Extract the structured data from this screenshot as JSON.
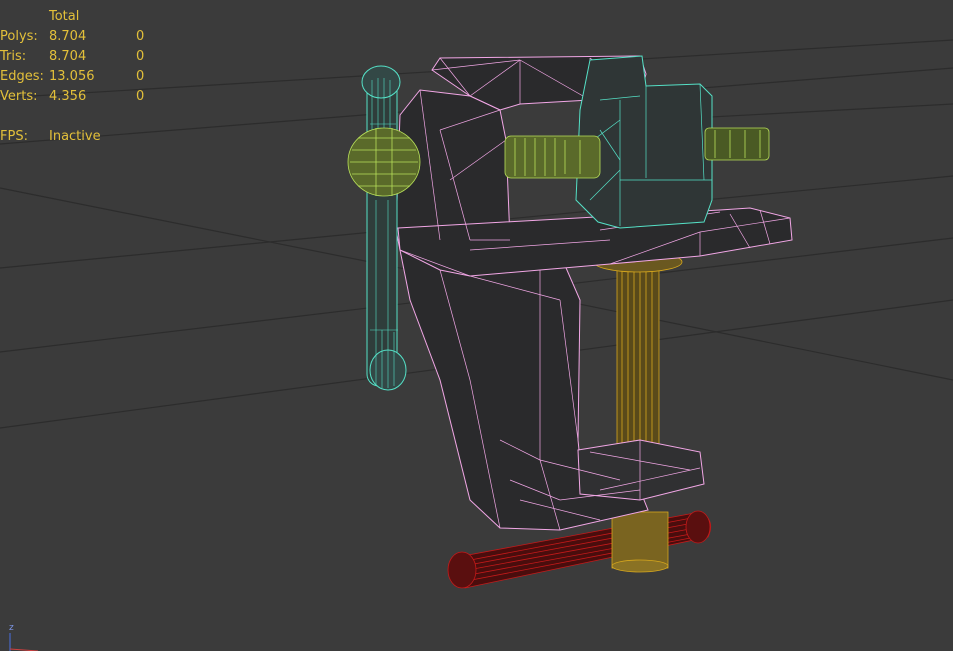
{
  "viewport": {
    "name": "3D perspective viewport"
  },
  "stats": {
    "header": "Total",
    "rows": [
      {
        "label": "Polys:",
        "total": "8.704",
        "selected": "0"
      },
      {
        "label": "Tris:",
        "total": "8.704",
        "selected": "0"
      },
      {
        "label": "Edges:",
        "total": "13.056",
        "selected": "0"
      },
      {
        "label": "Verts:",
        "total": "4.356",
        "selected": "0"
      }
    ],
    "fps_label": "FPS:",
    "fps_value": "Inactive"
  },
  "axis_gizmo": {
    "z_label": "z"
  },
  "colors": {
    "background": "#3b3b3b",
    "grid": "#2b2b2b",
    "stats_text": "#e3c03a",
    "body_wire": "#f2a7e6",
    "handle_wire": "#55e0c6",
    "knob_wire": "#b8e05a",
    "clamp_screw_wire": "#d6a71e",
    "clamp_handle_wire": "#c41a1a"
  }
}
